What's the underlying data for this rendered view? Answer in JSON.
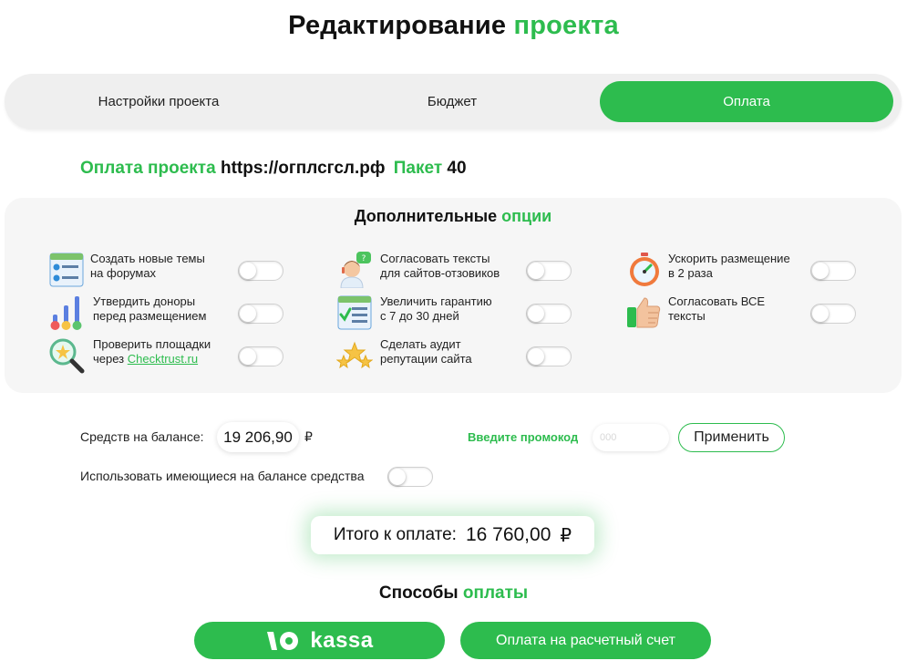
{
  "header": {
    "title_part1": "Редактирование",
    "title_part2": "проекта"
  },
  "tabs": [
    {
      "label": "Настройки проекта",
      "active": false
    },
    {
      "label": "Бюджет",
      "active": false
    },
    {
      "label": "Оплата",
      "active": true
    }
  ],
  "project": {
    "label": "Оплата проекта",
    "url": "https://огплсгсл.рф",
    "package_label": "Пакет",
    "package_value": "40"
  },
  "options": {
    "title_part1": "Дополнительные",
    "title_part2": "опции",
    "items": [
      {
        "line1": "Создать новые темы",
        "line2": "на форумах",
        "icon": "forum-topics-icon",
        "enabled": false
      },
      {
        "line1": "Согласовать тексты",
        "line2": "для сайтов-отзовиков",
        "icon": "support-agent-icon",
        "enabled": false
      },
      {
        "line1": "Ускорить размещение",
        "line2": "в 2 раза",
        "icon": "stopwatch-icon",
        "enabled": false
      },
      {
        "line1": "Утвердить доноры",
        "line2": "перед размещением",
        "icon": "rating-bars-icon",
        "enabled": false
      },
      {
        "line1": "Увеличить гарантию",
        "line2": "с 7 до 30 дней",
        "icon": "guarantee-checklist-icon",
        "enabled": false
      },
      {
        "line1": "Согласовать ВСЕ",
        "line2": "тексты",
        "icon": "thumbs-up-icon",
        "enabled": false
      },
      {
        "line1": "Проверить площадки",
        "line2_prefix": "через",
        "link": "Checktrust.ru",
        "icon": "magnifier-star-icon",
        "enabled": false
      },
      {
        "line1": "Сделать аудит",
        "line2": "репутации сайта",
        "icon": "stars-icon",
        "enabled": false
      }
    ]
  },
  "balance": {
    "label": "Средств на балансе:",
    "value": "19 206,90",
    "currency": "₽"
  },
  "promo": {
    "label": "Введите промокод",
    "placeholder": "000",
    "value": "",
    "apply_label": "Применить"
  },
  "use_balance": {
    "label": "Использовать имеющиеся на балансе средства",
    "enabled": false
  },
  "total": {
    "label": "Итого к оплате:",
    "value": "16 760,00",
    "currency": "₽"
  },
  "payment": {
    "title_part1": "Способы",
    "title_part2": "оплаты",
    "kassa_text": "kassa",
    "account_label": "Оплата на расчетный счет"
  },
  "colors": {
    "accent": "#2dbc4e",
    "panel": "#f6f6f6",
    "tabs_bg": "#efefef"
  }
}
